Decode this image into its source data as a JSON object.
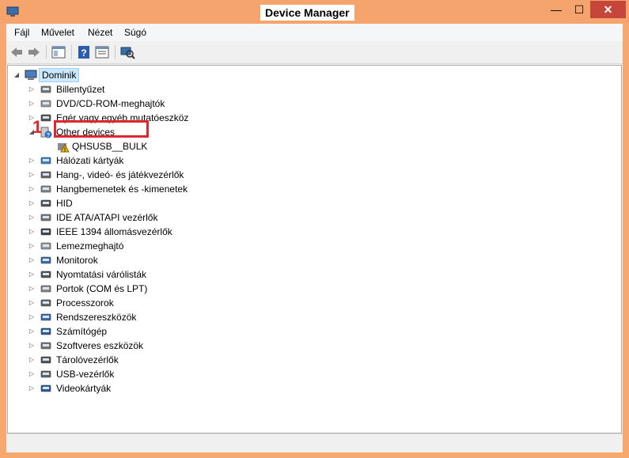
{
  "window": {
    "title": "Device Manager",
    "minimize": "—",
    "maximize": "☐",
    "close": "✕"
  },
  "menu": [
    "Fájl",
    "Művelet",
    "Nézet",
    "Súgó"
  ],
  "toolbar": [
    "back-icon",
    "forward-icon",
    "show-hide-tree-icon",
    "help-icon",
    "properties-icon",
    "scan-hardware-icon"
  ],
  "tree": {
    "root": "Dominik",
    "categories": [
      {
        "label": "Billentyűzet",
        "icon": "keyboard-icon"
      },
      {
        "label": "DVD/CD-ROM-meghajtók",
        "icon": "dvd-icon"
      },
      {
        "label": "Egér vagy egyéb mutatóeszköz",
        "icon": "mouse-icon"
      },
      {
        "label": "Other devices",
        "icon": "unknown-device-icon",
        "expanded": true
      },
      {
        "label": "Hálózati kártyák",
        "icon": "network-icon"
      },
      {
        "label": "Hang-, videó- és játékvezérlők",
        "icon": "audio-icon"
      },
      {
        "label": "Hangbemenetek és -kimenetek",
        "icon": "speaker-icon"
      },
      {
        "label": "HID",
        "icon": "hid-icon"
      },
      {
        "label": "IDE ATA/ATAPI vezérlők",
        "icon": "ide-icon"
      },
      {
        "label": "IEEE 1394 állomásvezérlők",
        "icon": "firewire-icon"
      },
      {
        "label": "Lemezmeghajtó",
        "icon": "disk-icon"
      },
      {
        "label": "Monitorok",
        "icon": "monitor-icon"
      },
      {
        "label": "Nyomtatási várólisták",
        "icon": "printer-icon"
      },
      {
        "label": "Portok (COM és LPT)",
        "icon": "port-icon"
      },
      {
        "label": "Processzorok",
        "icon": "cpu-icon"
      },
      {
        "label": "Rendszereszközök",
        "icon": "system-icon"
      },
      {
        "label": "Számítógép",
        "icon": "computer-icon"
      },
      {
        "label": "Szoftveres eszközök",
        "icon": "software-icon"
      },
      {
        "label": "Tárolóvezérlők",
        "icon": "storage-icon"
      },
      {
        "label": "USB-vezérlők",
        "icon": "usb-icon"
      },
      {
        "label": "Videokártyák",
        "icon": "display-adapter-icon"
      }
    ],
    "other_devices_child": "QHSUSB__BULK"
  },
  "annotation": {
    "marker": "1",
    "color": "#e0262e"
  },
  "colors": {
    "titlebar": "#f4a46c",
    "selection": "#cce8ff"
  }
}
